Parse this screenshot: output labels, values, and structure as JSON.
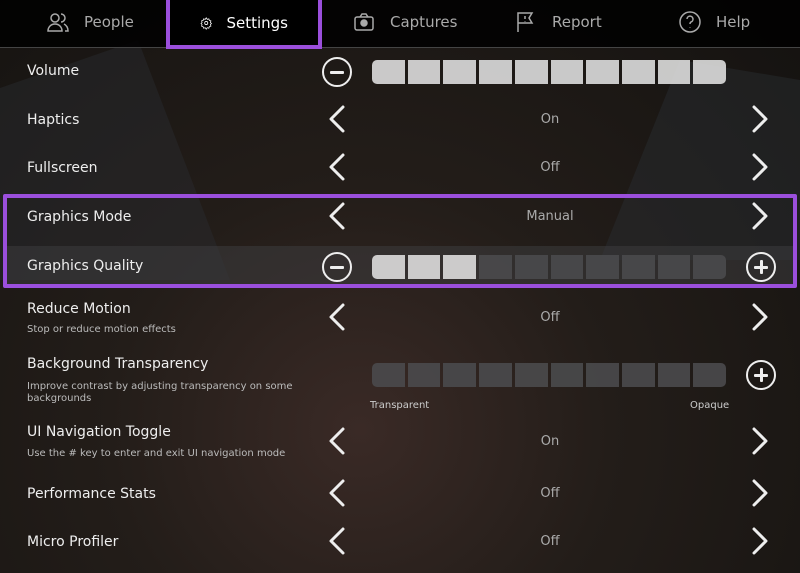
{
  "tabs": [
    {
      "label": "People",
      "icon": "people-icon"
    },
    {
      "label": "Settings",
      "icon": "gear-icon",
      "active": true
    },
    {
      "label": "Captures",
      "icon": "camera-icon"
    },
    {
      "label": "Report",
      "icon": "flag-icon"
    },
    {
      "label": "Help",
      "icon": "help-icon"
    }
  ],
  "settings": {
    "volume": {
      "label": "Volume",
      "level": 10,
      "segments": 10
    },
    "haptics": {
      "label": "Haptics",
      "value": "On"
    },
    "fullscreen": {
      "label": "Fullscreen",
      "value": "Off"
    },
    "graphics_mode": {
      "label": "Graphics Mode",
      "value": "Manual"
    },
    "graphics_quality": {
      "label": "Graphics Quality",
      "level": 3,
      "segments": 10
    },
    "reduce_motion": {
      "label": "Reduce Motion",
      "description": "Stop or reduce motion effects",
      "value": "Off"
    },
    "background_transparency": {
      "label": "Background Transparency",
      "description": "Improve contrast by adjusting transparency on some backgrounds",
      "level": 0,
      "segments": 10,
      "min_label": "Transparent",
      "max_label": "Opaque"
    },
    "ui_navigation": {
      "label": "UI Navigation Toggle",
      "description": "Use the # key to enter and exit UI navigation mode",
      "value": "On"
    },
    "performance_stats": {
      "label": "Performance Stats",
      "value": "Off"
    },
    "micro_profiler": {
      "label": "Micro Profiler",
      "value": "Off"
    }
  },
  "colors": {
    "highlight": "#9b4fdc",
    "segment_on": "#dddddd",
    "segment_off": "#4a4a4c"
  }
}
